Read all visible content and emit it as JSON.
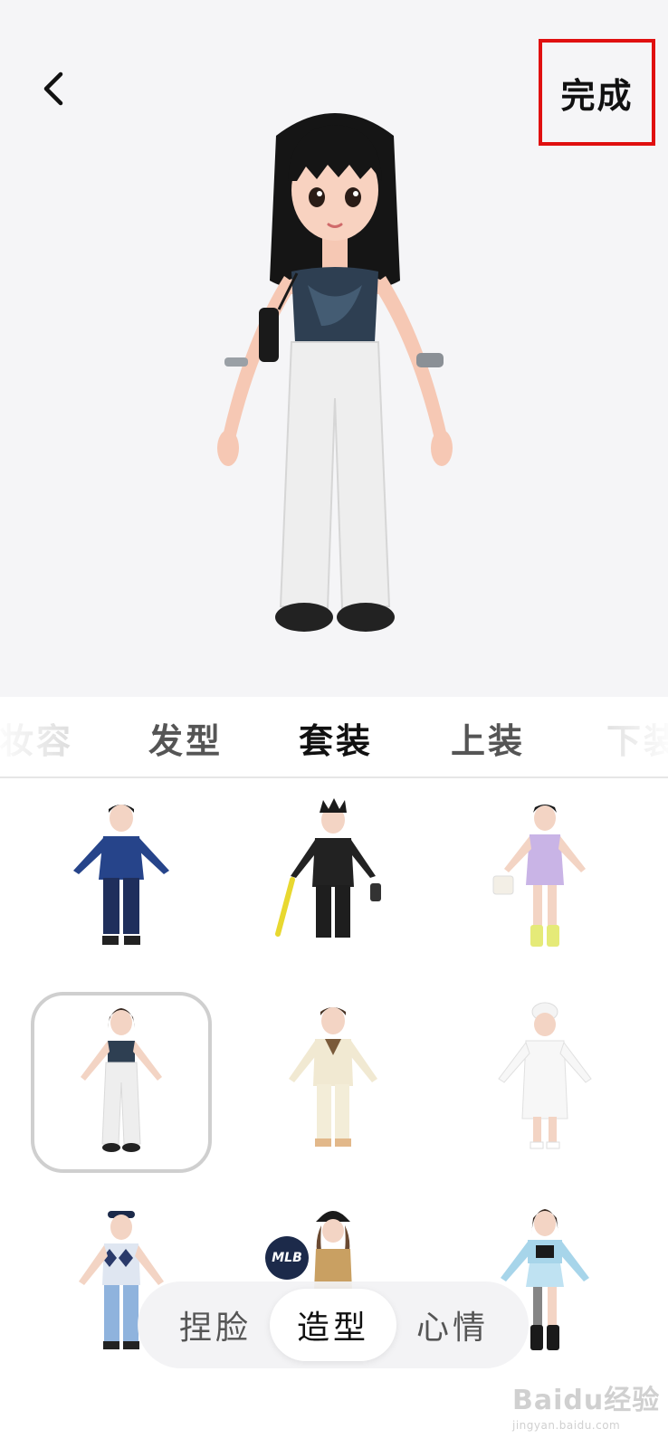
{
  "header": {
    "back_icon": "chevron-left-icon",
    "done_label": "完成",
    "done_highlight_color": "#e01010"
  },
  "categories": [
    {
      "label": "妆容",
      "state": "faded"
    },
    {
      "label": "发型",
      "state": "normal"
    },
    {
      "label": "套装",
      "state": "active"
    },
    {
      "label": "上装",
      "state": "normal"
    },
    {
      "label": "下装",
      "state": "faded"
    }
  ],
  "outfits": [
    {
      "name": "blue-denim-jacket-outfit",
      "selected": false
    },
    {
      "name": "black-suit-bat-outfit",
      "selected": false
    },
    {
      "name": "lilac-dress-outfit",
      "selected": false
    },
    {
      "name": "tube-top-white-pants-outfit",
      "selected": true
    },
    {
      "name": "cream-sailor-outfit",
      "selected": false
    },
    {
      "name": "white-bathrobe-outfit",
      "selected": false
    },
    {
      "name": "argyle-vest-jeans-outfit",
      "selected": false
    },
    {
      "name": "mlb-cap-outfit",
      "selected": false
    },
    {
      "name": "cropped-jacket-skirt-outfit",
      "selected": false
    }
  ],
  "mlb_badge": "MLB",
  "modes": [
    {
      "label": "捏脸",
      "active": false
    },
    {
      "label": "造型",
      "active": true
    },
    {
      "label": "心情",
      "active": false
    }
  ],
  "watermark": {
    "main": "Baidu经验",
    "sub": "jingyan.baidu.com"
  }
}
